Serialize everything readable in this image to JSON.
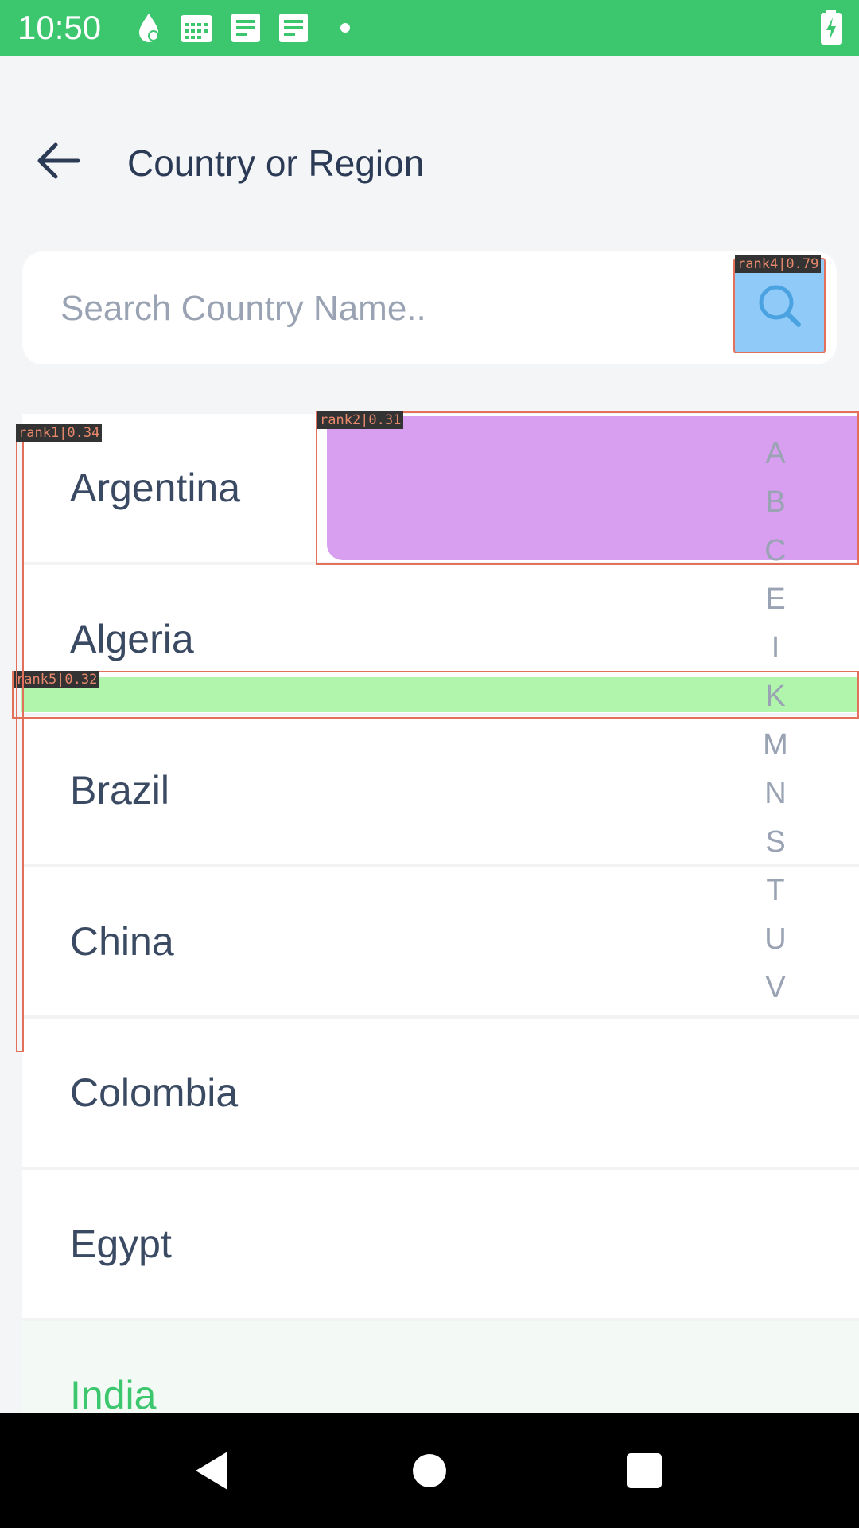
{
  "status_bar": {
    "time": "10:50",
    "icons": [
      "notification-icon",
      "calendar-icon",
      "document-icon",
      "document-icon",
      "dot-icon",
      "battery-charging-icon"
    ]
  },
  "header": {
    "title": "Country or Region",
    "back_icon": "arrow-back-icon"
  },
  "search": {
    "placeholder": "Search Country Name..",
    "value": "",
    "icon": "search-icon"
  },
  "countries": [
    {
      "name": "Argentina",
      "selected": false
    },
    {
      "name": "Algeria",
      "selected": false
    },
    {
      "name": "Brazil",
      "selected": false
    },
    {
      "name": "China",
      "selected": false
    },
    {
      "name": "Colombia",
      "selected": false
    },
    {
      "name": "Egypt",
      "selected": false
    },
    {
      "name": "India",
      "selected": true
    }
  ],
  "alphabet_index": [
    "A",
    "B",
    "C",
    "E",
    "I",
    "K",
    "M",
    "N",
    "S",
    "T",
    "U",
    "V"
  ],
  "overlays": [
    {
      "label": "rank1|0.34"
    },
    {
      "label": "rank2|0.31"
    },
    {
      "label": "rank4|0.79"
    },
    {
      "label": "rank5|0.32"
    }
  ],
  "colors": {
    "accent": "#3cc76f",
    "title": "#2b3a55",
    "muted": "#9aa3b3",
    "overlay_border": "#e2705a"
  },
  "nav": {
    "back_icon": "nav-back-icon",
    "home_icon": "nav-home-icon",
    "recents_icon": "nav-recents-icon"
  }
}
